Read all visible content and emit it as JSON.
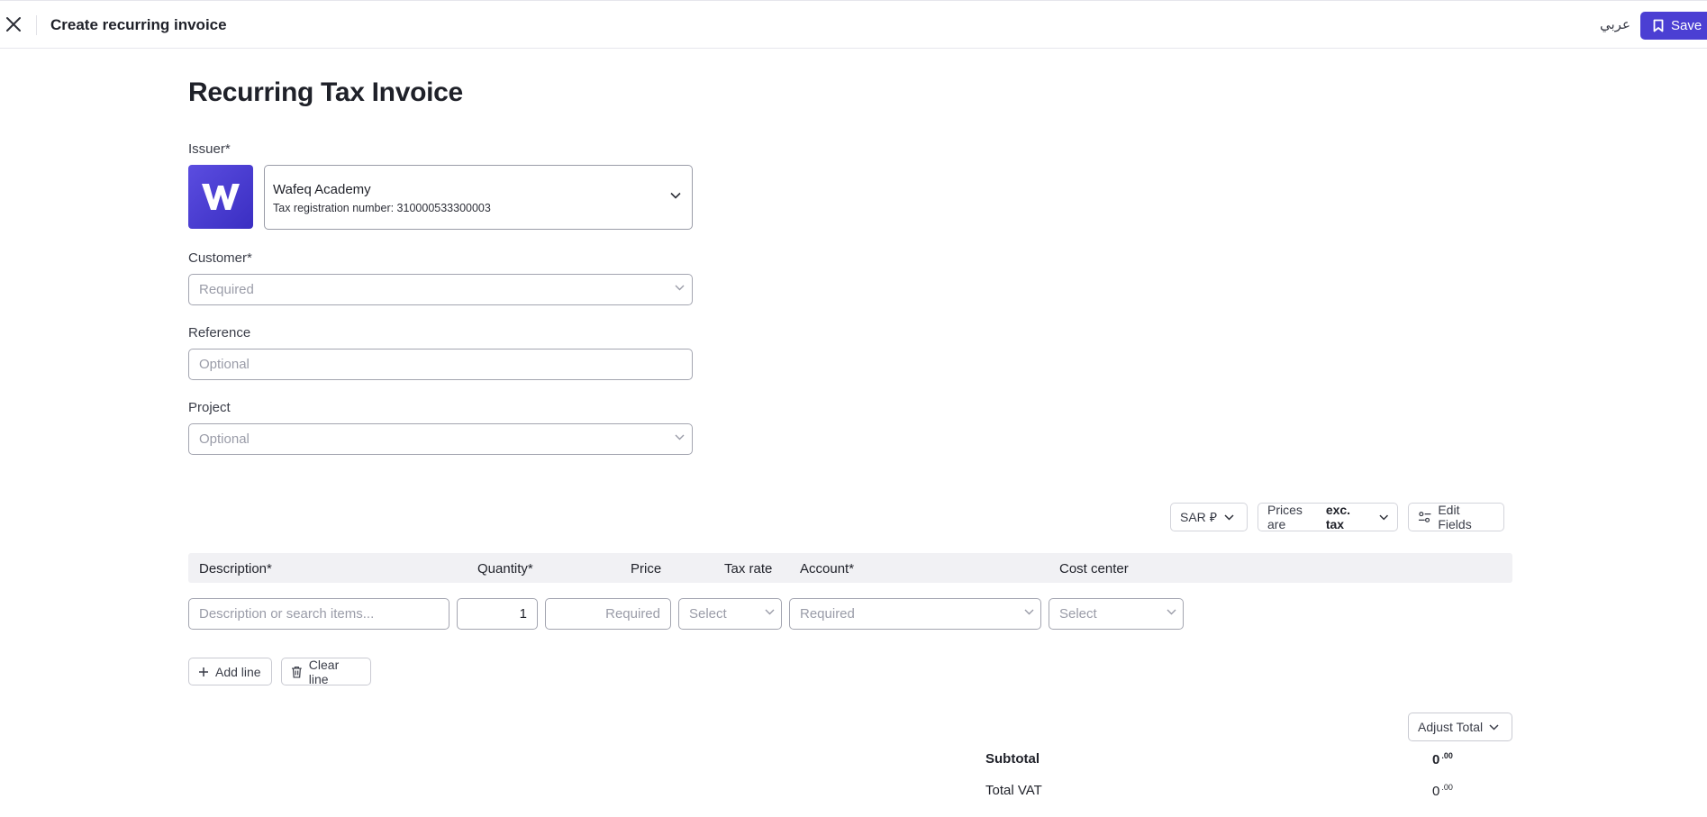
{
  "topbar": {
    "close_icon": "close-icon",
    "title": "Create recurring invoice",
    "language_toggle": "عربي",
    "save_label": "Save",
    "accent_color": "#4b3fd3"
  },
  "page": {
    "heading": "Recurring Tax Invoice"
  },
  "issuer": {
    "label": "Issuer*",
    "logo_icon": "wafeq-logo",
    "name": "Wafeq Academy",
    "tax_line": "Tax registration number: 310000533300003"
  },
  "customer": {
    "label": "Customer*",
    "placeholder": "Required"
  },
  "reference": {
    "label": "Reference",
    "placeholder": "Optional"
  },
  "project": {
    "label": "Project",
    "placeholder": "Optional"
  },
  "toolbar": {
    "currency": "SAR ⃁",
    "prices_prefix": "Prices are",
    "prices_mode": "exc. tax",
    "edit_fields": "Edit Fields"
  },
  "table": {
    "headers": {
      "description": "Description*",
      "quantity": "Quantity*",
      "price": "Price",
      "tax_rate": "Tax rate",
      "account": "Account*",
      "cost_center": "Cost center"
    },
    "row": {
      "description_placeholder": "Description or search items...",
      "quantity": "1",
      "price_placeholder": "Required",
      "tax_rate_placeholder": "Select",
      "account_placeholder": "Required",
      "cost_center_placeholder": "Select"
    }
  },
  "actions": {
    "add_line": "Add line",
    "clear_line": "Clear line",
    "adjust_total": "Adjust Total"
  },
  "totals": {
    "subtotal_label": "Subtotal",
    "subtotal_int": "0",
    "subtotal_dec": ".00",
    "vat_label": "Total VAT",
    "vat_int": "0",
    "vat_dec": ".00"
  }
}
